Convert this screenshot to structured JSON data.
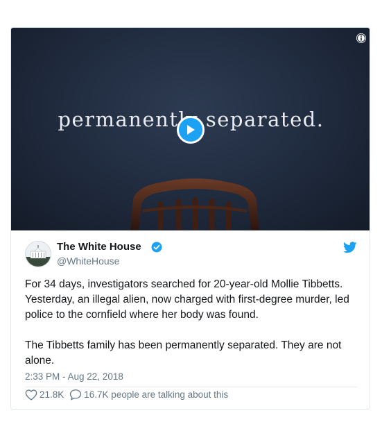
{
  "media": {
    "overlay_text": "permanently separated."
  },
  "tweet": {
    "author_name": "The White House",
    "author_handle": "@WhiteHouse",
    "text_paragraphs": [
      "For 34 days, investigators searched for 20-year-old Mollie Tibbetts. Yesterday, an illegal alien, now charged with first-degree murder, led police to the cornfield where her body was found.",
      "The Tibbetts family has been permanently separated. They are not alone."
    ],
    "timestamp": "2:33 PM - Aug 22, 2018",
    "like_count": "21.8K",
    "talking_text": "16.7K people are talking about this"
  },
  "colors": {
    "twitter_blue": "#1da1f2",
    "text_primary": "#14171a",
    "text_secondary": "#657786",
    "border": "#e1e8ed"
  },
  "icons": [
    "play-icon",
    "info-icon",
    "verified-badge-icon",
    "twitter-bird-icon",
    "heart-icon",
    "comment-icon"
  ]
}
